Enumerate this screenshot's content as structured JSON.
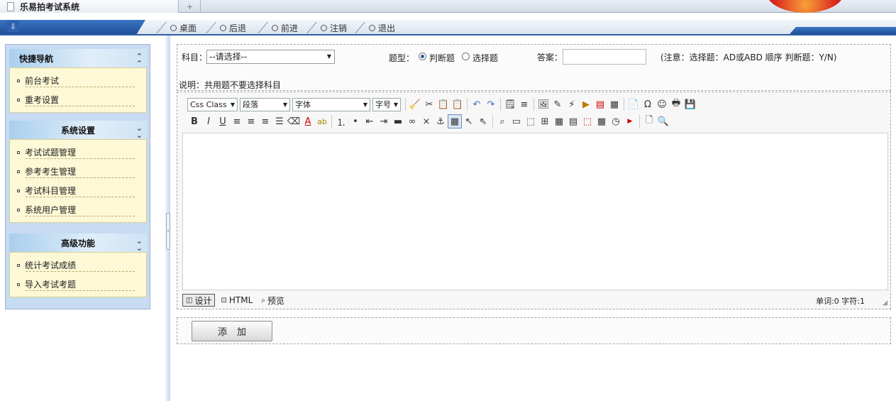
{
  "tabs": {
    "active_title": "乐易拍考试系统",
    "new_tab": "+"
  },
  "nav": {
    "items": [
      {
        "label": "桌面"
      },
      {
        "label": "后退"
      },
      {
        "label": "前进"
      },
      {
        "label": "注销"
      },
      {
        "label": "退出"
      }
    ]
  },
  "sidebar": {
    "groups": [
      {
        "title": "快捷导航",
        "chevron": "up",
        "items": [
          {
            "label": "前台考试"
          },
          {
            "label": "重考设置"
          }
        ]
      },
      {
        "title": "系统设置",
        "chevron": "down",
        "items": [
          {
            "label": "考试试题管理"
          },
          {
            "label": "参考考生管理"
          },
          {
            "label": "考试科目管理"
          },
          {
            "label": "系统用户管理"
          }
        ]
      },
      {
        "title": "高级功能",
        "chevron": "down",
        "items": [
          {
            "label": "统计考试成绩"
          },
          {
            "label": "导入考试考题"
          }
        ]
      }
    ]
  },
  "form": {
    "subject_label": "科目：",
    "subject_value": "--请选择--",
    "type_label": "题型：",
    "type_options": [
      {
        "label": "判断题",
        "selected": true
      },
      {
        "label": "选择题",
        "selected": false
      }
    ],
    "answer_label": "答案：",
    "answer_value": "",
    "note": "(注意：选择题：AD或ABD 顺序  判断题：Y/N)",
    "description": "说明：共用题不要选择科目"
  },
  "editor": {
    "css_class": "Css Class",
    "paragraph": "段落",
    "font": "字体",
    "font_size": "字号",
    "modes": {
      "design": "设计",
      "html": "HTML",
      "preview": "预览"
    },
    "word_count": "单词:0 字符:1"
  },
  "submit": {
    "label": "添加"
  }
}
